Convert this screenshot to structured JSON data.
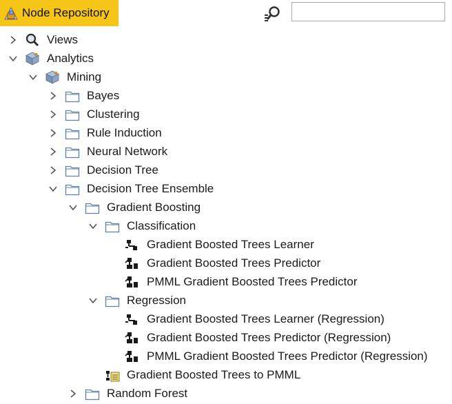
{
  "header": {
    "title": "Node Repository",
    "search_value": "",
    "search_placeholder": ""
  },
  "colors": {
    "tab_background": "#f5c518",
    "folder_outline": "#5f7fa6",
    "chevron": "#555555"
  },
  "tree": [
    {
      "label": "Views",
      "icon": "magnifier-icon",
      "level": 0,
      "expanded": false
    },
    {
      "label": "Analytics",
      "icon": "cube-category-icon",
      "level": 0,
      "expanded": true
    },
    {
      "label": "Mining",
      "icon": "cube-category-icon",
      "level": 1,
      "expanded": true
    },
    {
      "label": "Bayes",
      "icon": "folder-icon",
      "level": 2,
      "expanded": false
    },
    {
      "label": "Clustering",
      "icon": "folder-icon",
      "level": 2,
      "expanded": false
    },
    {
      "label": "Rule Induction",
      "icon": "folder-icon",
      "level": 2,
      "expanded": false
    },
    {
      "label": "Neural Network",
      "icon": "folder-icon",
      "level": 2,
      "expanded": false
    },
    {
      "label": "Decision Tree",
      "icon": "folder-icon",
      "level": 2,
      "expanded": false
    },
    {
      "label": "Decision Tree Ensemble",
      "icon": "folder-icon",
      "level": 2,
      "expanded": true
    },
    {
      "label": "Gradient Boosting",
      "icon": "folder-icon",
      "level": 3,
      "expanded": true
    },
    {
      "label": "Classification",
      "icon": "folder-icon",
      "level": 4,
      "expanded": true
    },
    {
      "label": "Gradient Boosted Trees Learner",
      "icon": "learner-node-icon",
      "level": 5,
      "expanded": null
    },
    {
      "label": "Gradient Boosted Trees Predictor",
      "icon": "predictor-node-icon",
      "level": 5,
      "expanded": null
    },
    {
      "label": "PMML Gradient Boosted Trees Predictor",
      "icon": "predictor-node-icon",
      "level": 5,
      "expanded": null
    },
    {
      "label": "Regression",
      "icon": "folder-icon",
      "level": 4,
      "expanded": true
    },
    {
      "label": "Gradient Boosted Trees Learner (Regression)",
      "icon": "learner-node-icon",
      "level": 5,
      "expanded": null
    },
    {
      "label": "Gradient Boosted Trees Predictor (Regression)",
      "icon": "predictor-node-icon",
      "level": 5,
      "expanded": null
    },
    {
      "label": "PMML Gradient Boosted Trees Predictor (Regression)",
      "icon": "predictor-node-icon",
      "level": 5,
      "expanded": null
    },
    {
      "label": "Gradient Boosted Trees to PMML",
      "icon": "pmml-converter-icon",
      "level": 4,
      "expanded": null
    },
    {
      "label": "Random Forest",
      "icon": "folder-icon",
      "level": 3,
      "expanded": false
    }
  ]
}
